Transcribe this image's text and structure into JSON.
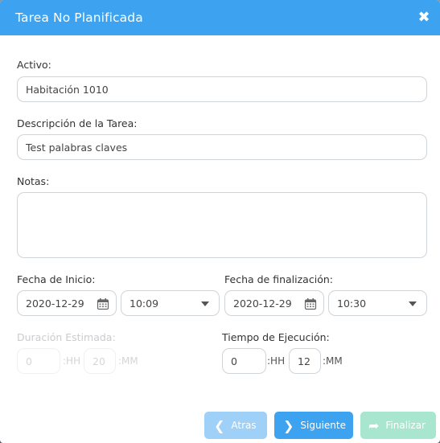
{
  "modal": {
    "title": "Tarea No Planificada",
    "close_icon": "close-icon"
  },
  "form": {
    "activo_label": "Activo:",
    "activo_value": "Habitación 1010",
    "descripcion_label": "Descripción de la Tarea:",
    "descripcion_value": "Test palabras claves",
    "notas_label": "Notas:",
    "notas_value": "",
    "fecha_inicio_label": "Fecha de Inicio:",
    "fecha_inicio_date": "2020-12-29",
    "fecha_inicio_time": "10:09",
    "fecha_fin_label": "Fecha de finalización:",
    "fecha_fin_date": "2020-12-29",
    "fecha_fin_time": "10:30",
    "duracion_label": "Duración Estimada:",
    "duracion_hh": "0",
    "duracion_hh_unit": ":HH",
    "duracion_mm": "20",
    "duracion_mm_unit": ":MM",
    "tiempo_label": "Tiempo de Ejecución:",
    "tiempo_hh": "0",
    "tiempo_hh_unit": ":HH",
    "tiempo_mm": "12",
    "tiempo_mm_unit": ":MM"
  },
  "footer": {
    "back_label": "Atras",
    "next_label": "Siguiente",
    "finish_label": "Finalizar"
  },
  "colors": {
    "header": "#3da2f0",
    "primary_button": "#3da2f0",
    "disabled_back": "#9fd0f7",
    "disabled_finish": "#a8e6cf"
  }
}
